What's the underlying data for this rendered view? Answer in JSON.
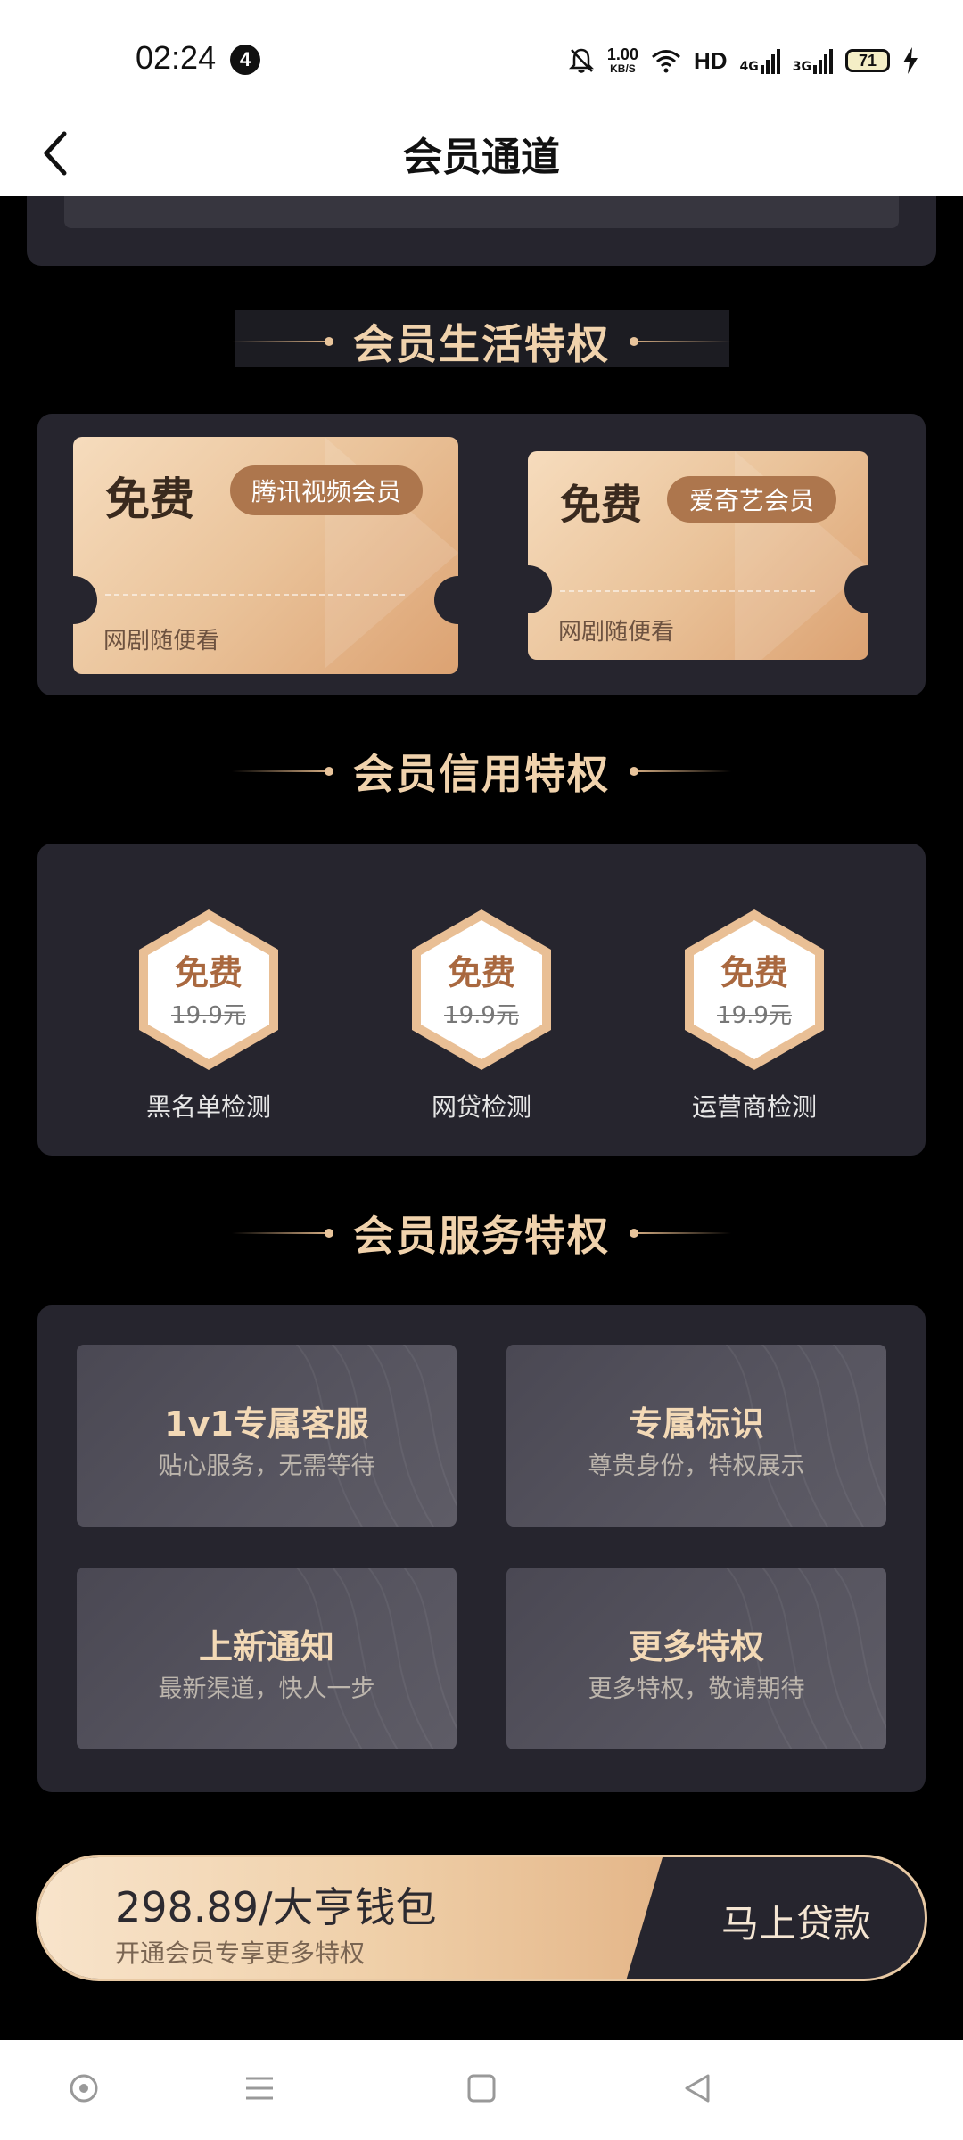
{
  "status_bar": {
    "time": "02:24",
    "notification_count": "4",
    "net_speed_value": "1.00",
    "net_speed_unit": "KB/S",
    "hd": "HD",
    "signal_1": "4G",
    "signal_2": "3G",
    "battery": "71"
  },
  "nav": {
    "title": "会员通道"
  },
  "sections": {
    "life": "会员生活特权",
    "credit": "会员信用特权",
    "service": "会员服务特权"
  },
  "life_perks": [
    {
      "free": "免费",
      "tag": "腾讯视频会员",
      "desc": "网剧随便看"
    },
    {
      "free": "免费",
      "tag": "爱奇艺会员",
      "desc": "网剧随便看"
    }
  ],
  "credit_perks": [
    {
      "free": "免费",
      "price": "19.9元",
      "label": "黑名单检测"
    },
    {
      "free": "免费",
      "price": "19.9元",
      "label": "网贷检测"
    },
    {
      "free": "免费",
      "price": "19.9元",
      "label": "运营商检测"
    }
  ],
  "service_perks": [
    {
      "title": "1v1专属客服",
      "sub": "贴心服务，无需等待"
    },
    {
      "title": "专属标识",
      "sub": "尊贵身份，特权展示"
    },
    {
      "title": "上新通知",
      "sub": "最新渠道，快人一步"
    },
    {
      "title": "更多特权",
      "sub": "更多特权，敬请期待"
    }
  ],
  "cta": {
    "price": "298.89/大亨钱包",
    "sub": "开通会员专享更多特权",
    "button": "马上贷款"
  },
  "colors": {
    "gold": "#f0d2ac",
    "panel": "#26252e",
    "background": "#000000"
  }
}
